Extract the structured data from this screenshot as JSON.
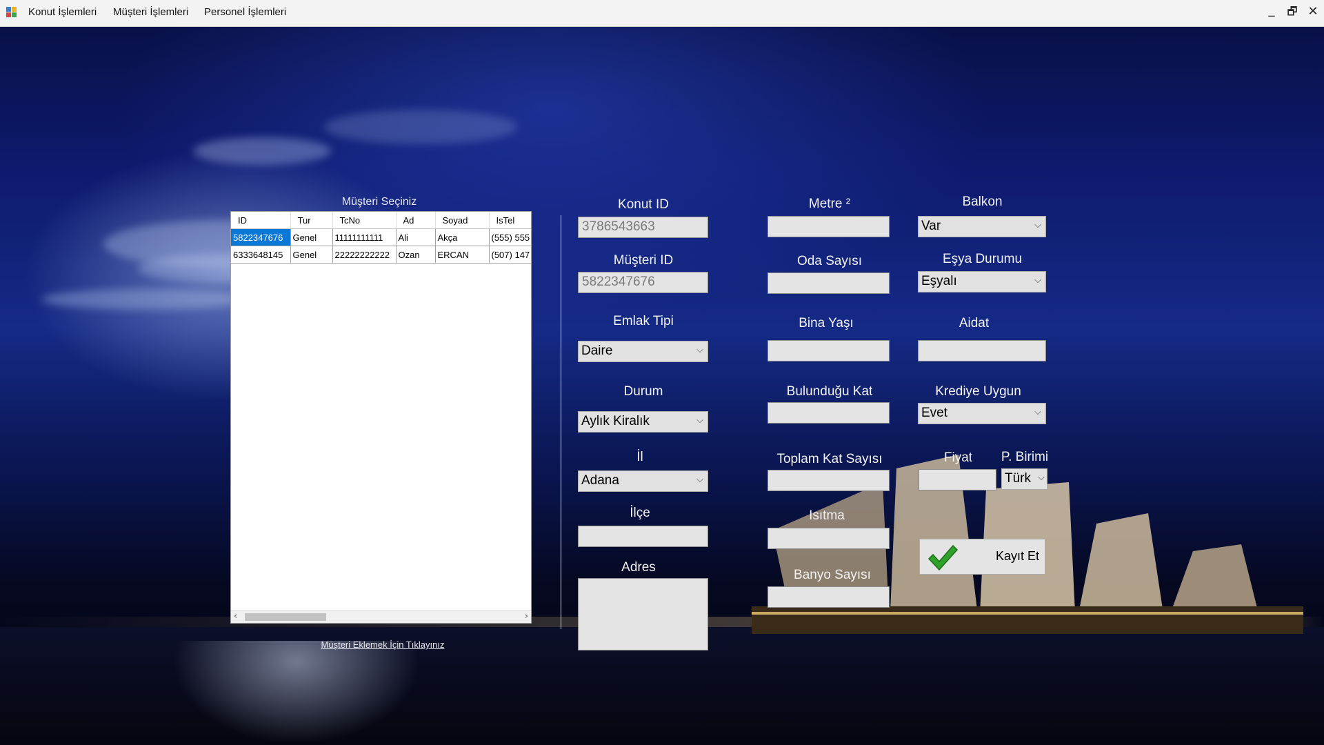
{
  "menu": {
    "items": [
      "Konut İşlemleri",
      "Müşteri İşlemleri",
      "Personel İşlemleri"
    ],
    "window_controls": {
      "minimize": "_",
      "restore": "🗗",
      "close": "✕"
    }
  },
  "grid": {
    "title": "Müşteri Seçiniz",
    "columns": [
      "ID",
      "Tur",
      "TcNo",
      "Ad",
      "Soyad",
      "IsTel"
    ],
    "rows": [
      [
        "5822347676",
        "Genel",
        "11111111111",
        "Ali",
        "Akça",
        "(555) 555"
      ],
      [
        "6333648145",
        "Genel",
        "22222222222",
        "Ozan",
        "ERCAN",
        "(507) 147"
      ]
    ],
    "selected_row": 0,
    "add_link": "Müşteri Eklemek İçin Tıklayınız"
  },
  "form": {
    "konut_id": {
      "label": "Konut ID",
      "value": "3786543663"
    },
    "musteri_id": {
      "label": "Müşteri ID",
      "value": "5822347676"
    },
    "emlak_tipi": {
      "label": "Emlak Tipi",
      "value": "Daire"
    },
    "durum": {
      "label": "Durum",
      "value": "Aylık Kiralık"
    },
    "il": {
      "label": "İl",
      "value": "Adana"
    },
    "ilce": {
      "label": "İlçe",
      "value": ""
    },
    "adres": {
      "label": "Adres",
      "value": ""
    },
    "metre": {
      "label": "Metre ²",
      "value": ""
    },
    "oda_sayisi": {
      "label": "Oda Sayısı",
      "value": ""
    },
    "bina_yasi": {
      "label": "Bina Yaşı",
      "value": ""
    },
    "bulundugu_kat": {
      "label": "Bulunduğu Kat",
      "value": ""
    },
    "toplam_kat": {
      "label": "Toplam Kat Sayısı",
      "value": ""
    },
    "isitma": {
      "label": "Isıtma",
      "value": ""
    },
    "banyo": {
      "label": "Banyo Sayısı",
      "value": ""
    },
    "balkon": {
      "label": "Balkon",
      "value": "Var"
    },
    "esya_durumu": {
      "label": "Eşya Durumu",
      "value": "Eşyalı"
    },
    "aidat": {
      "label": "Aidat",
      "value": ""
    },
    "krediye_uygun": {
      "label": "Krediye Uygun",
      "value": "Evet"
    },
    "fiyat": {
      "label": "Fiyat",
      "value": ""
    },
    "para_birimi": {
      "label": "P. Birimi",
      "value": "Türk"
    },
    "save_label": "Kayıt Et"
  },
  "colors": {
    "selection": "#0a78d7",
    "check": "#2fa12a"
  }
}
